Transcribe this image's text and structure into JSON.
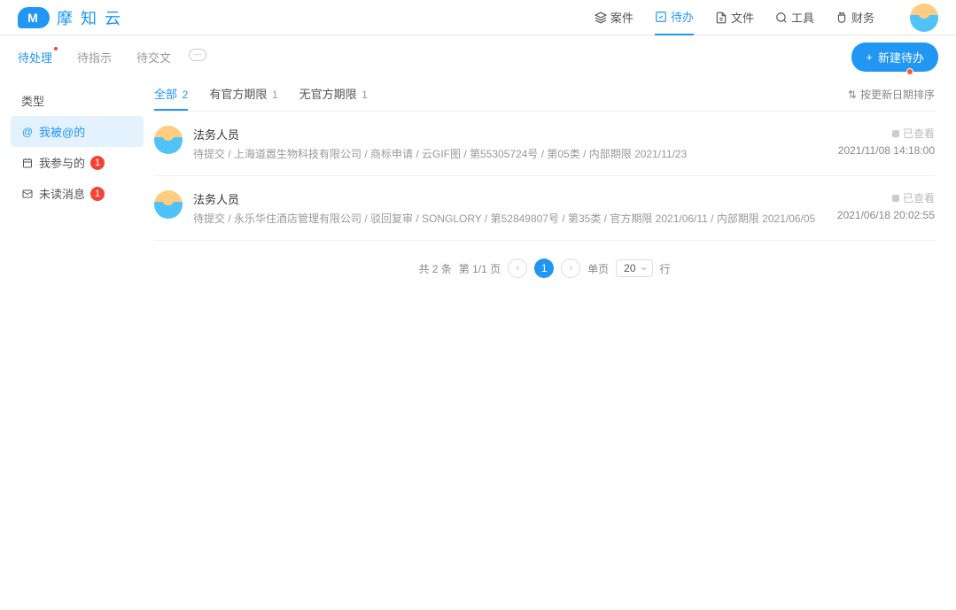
{
  "brand": "摩 知 云",
  "nav": {
    "cases": "案件",
    "todo": "待办",
    "files": "文件",
    "tools": "工具",
    "finance": "财务"
  },
  "subtabs": {
    "pending": "待处理",
    "instruct": "待指示",
    "submit": "待交文"
  },
  "new_btn": "新建待办",
  "sidebar": {
    "title": "类型",
    "at_me": "我被@的",
    "participate": "我参与的",
    "participate_badge": "1",
    "unread": "未读消息",
    "unread_badge": "1"
  },
  "filters": {
    "all": "全部",
    "all_count": "2",
    "has_deadline": "有官方期限",
    "has_deadline_count": "1",
    "no_deadline": "无官方期限",
    "no_deadline_count": "1"
  },
  "sort_label": "按更新日期排序",
  "items": [
    {
      "title": "法务人员",
      "meta": "待提交 / 上海道嚣生物科技有限公司 / 商标申请 / 云GIF图 / 第55305724号 / 第05类 / 内部期限 2021/11/23",
      "status": "已查看",
      "time": "2021/11/08 14:18:00"
    },
    {
      "title": "法务人员",
      "meta": "待提交 / 永乐华住酒店管理有限公司 / 驳回复审 / SONGLORY / 第52849807号 / 第35类 / 官方期限 2021/06/11 / 内部期限 2021/06/05",
      "status": "已查看",
      "time": "2021/06/18 20:02:55"
    }
  ],
  "pagination": {
    "total": "共 2 条",
    "page": "第 1/1 页",
    "current": "1",
    "perpage_label_pre": "单页",
    "perpage": "20",
    "perpage_label_post": "行"
  }
}
